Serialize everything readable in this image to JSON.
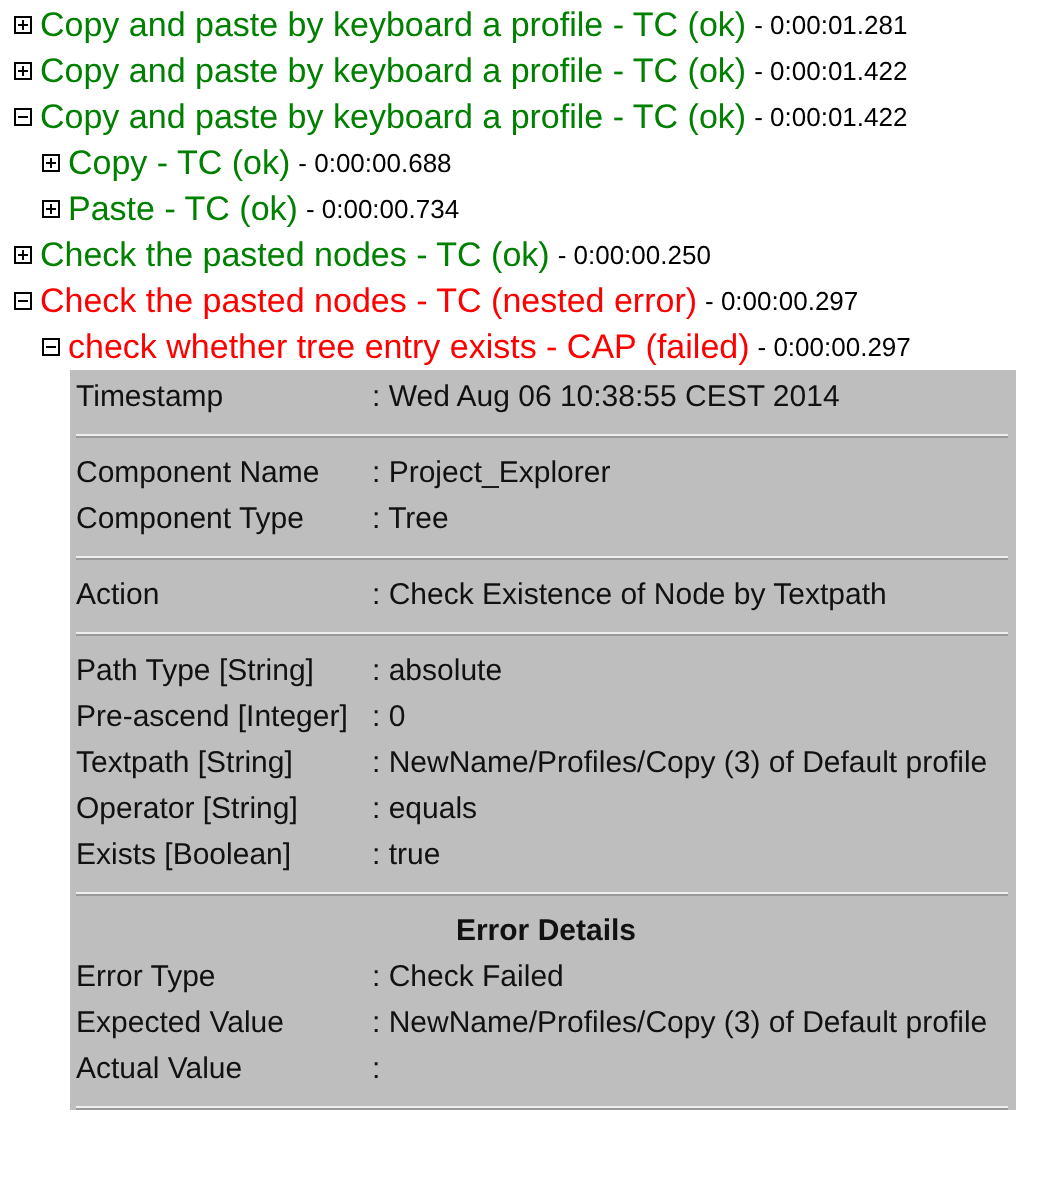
{
  "tree": [
    {
      "title": "Copy and paste by keyboard a profile - TC (ok)",
      "color": "#008000",
      "duration": "- 0:00:01.281",
      "expanded": false
    },
    {
      "title": "Copy and paste by keyboard a profile - TC (ok)",
      "color": "#008000",
      "duration": "- 0:00:01.422",
      "expanded": false
    },
    {
      "title": "Copy and paste by keyboard a profile - TC (ok)",
      "color": "#008000",
      "duration": "- 0:00:01.422",
      "expanded": true,
      "children": [
        {
          "title": "Copy - TC (ok)",
          "color": "#008000",
          "duration": "- 0:00:00.688",
          "expanded": false
        },
        {
          "title": "Paste - TC (ok)",
          "color": "#008000",
          "duration": "- 0:00:00.734",
          "expanded": false
        }
      ]
    },
    {
      "title": "Check the pasted nodes - TC (ok)",
      "color": "#008000",
      "duration": "- 0:00:00.250",
      "expanded": false
    },
    {
      "title": "Check the pasted nodes - TC (nested error)",
      "color": "#ff0000",
      "duration": "- 0:00:00.297",
      "expanded": true,
      "children": [
        {
          "title": "check whether tree entry exists - CAP (failed)",
          "color": "#ff0000",
          "duration": "- 0:00:00.297",
          "expanded": true,
          "details": {
            "sections": [
              {
                "rows": [
                  {
                    "label": "Timestamp",
                    "value": ": Wed Aug 06 10:38:55 CEST 2014"
                  }
                ]
              },
              {
                "rows": [
                  {
                    "label": "Component Name",
                    "value": ": Project_Explorer"
                  },
                  {
                    "label": "Component Type",
                    "value": ": Tree"
                  }
                ]
              },
              {
                "rows": [
                  {
                    "label": "Action",
                    "value": ": Check Existence of Node by Textpath"
                  }
                ]
              },
              {
                "rows": [
                  {
                    "label": "Path Type [String]",
                    "value": ": absolute"
                  },
                  {
                    "label": "Pre-ascend [Integer]",
                    "value": ": 0"
                  },
                  {
                    "label": "Textpath [String]",
                    "value": ": NewName/Profiles/Copy (3) of Default profile"
                  },
                  {
                    "label": "Operator [String]",
                    "value": ": equals"
                  },
                  {
                    "label": "Exists [Boolean]",
                    "value": ": true"
                  }
                ]
              },
              {
                "heading": "Error Details",
                "rows": [
                  {
                    "label": "Error Type",
                    "value": ": Check Failed"
                  },
                  {
                    "label": "Expected Value",
                    "value": ": NewName/Profiles/Copy (3) of Default profile"
                  },
                  {
                    "label": "Actual Value",
                    "value": ":"
                  }
                ]
              }
            ]
          }
        }
      ]
    }
  ]
}
